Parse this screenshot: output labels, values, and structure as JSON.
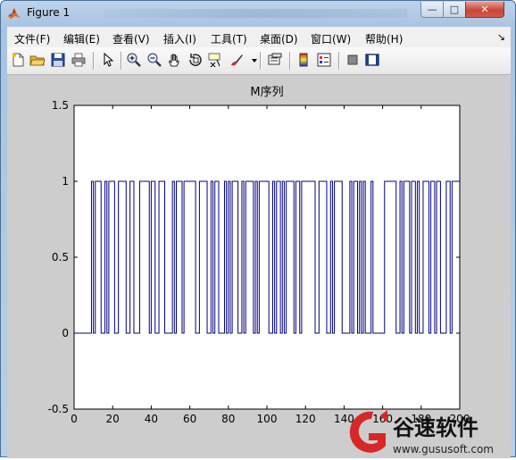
{
  "window": {
    "title": "Figure 1",
    "controls": {
      "minimize": "—",
      "maximize": "□",
      "close": "✕"
    }
  },
  "menu": {
    "items": [
      "文件(F)",
      "编辑(E)",
      "查看(V)",
      "插入(I)",
      "工具(T)",
      "桌面(D)",
      "窗口(W)",
      "帮助(H)"
    ],
    "overflow_arrow": "↘"
  },
  "toolbar": {
    "icons": [
      "new-figure-icon",
      "open-file-icon",
      "save-icon",
      "print-icon",
      "edit-plot-arrow-icon",
      "zoom-in-icon",
      "zoom-out-icon",
      "pan-hand-icon",
      "rotate-3d-icon",
      "data-cursor-icon",
      "brush-icon",
      "brush-dropdown-icon",
      "link-plot-icon",
      "colorbar-icon",
      "legend-icon",
      "hide-plot-tools-icon",
      "show-plot-tools-icon"
    ]
  },
  "chart_data": {
    "type": "line",
    "title": "M序列",
    "xlabel": "",
    "ylabel": "",
    "xlim": [
      0,
      200
    ],
    "ylim": [
      -0.5,
      1.5
    ],
    "xticks": [
      "0",
      "20",
      "40",
      "60",
      "80",
      "100",
      "120",
      "140",
      "160",
      "180",
      "200"
    ],
    "yticks": [
      "-0.5",
      "0",
      "0.5",
      "1",
      "1.5"
    ],
    "grid": false,
    "step": true,
    "series": [
      {
        "color": "#000080",
        "values": [
          0,
          0,
          0,
          0,
          0,
          0,
          0,
          0,
          1,
          0,
          1,
          1,
          1,
          0,
          0,
          1,
          0,
          1,
          1,
          1,
          0,
          0,
          1,
          1,
          1,
          1,
          0,
          0,
          1,
          1,
          0,
          0,
          0,
          1,
          1,
          1,
          1,
          1,
          0,
          1,
          1,
          0,
          0,
          1,
          1,
          1,
          0,
          0,
          0,
          0,
          1,
          0,
          1,
          1,
          1,
          0,
          1,
          1,
          1,
          1,
          1,
          1,
          0,
          0,
          1,
          1,
          1,
          1,
          0,
          0,
          1,
          0,
          1,
          1,
          0,
          0,
          0,
          1,
          0,
          1,
          0,
          1,
          1,
          1,
          0,
          0,
          1,
          0,
          1,
          1,
          1,
          1,
          0,
          1,
          0,
          1,
          1,
          1,
          1,
          1,
          0,
          0,
          1,
          0,
          1,
          1,
          0,
          1,
          0,
          1,
          1,
          1,
          1,
          0,
          1,
          1,
          0,
          1,
          1,
          1,
          1,
          1,
          1,
          1,
          0,
          0,
          1,
          1,
          1,
          1,
          0,
          0,
          1,
          0,
          1,
          1,
          1,
          1,
          0,
          0,
          0,
          0,
          1,
          0,
          1,
          1,
          0,
          1,
          0,
          1,
          0,
          0,
          0,
          1,
          0,
          0,
          0,
          0,
          0,
          0,
          1,
          1,
          1,
          1,
          1,
          1,
          0,
          0,
          1,
          0,
          1,
          1,
          1,
          0,
          1,
          1,
          0,
          1,
          0,
          0,
          1,
          1,
          1,
          0,
          1,
          1,
          0,
          1,
          1,
          0,
          0,
          0,
          1,
          1,
          0,
          1,
          1,
          1,
          1,
          1
        ]
      }
    ]
  },
  "watermark": {
    "brand": "谷速软件",
    "url": "www.gususoft.com"
  }
}
